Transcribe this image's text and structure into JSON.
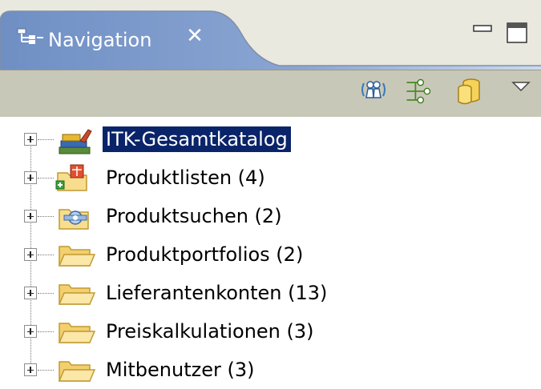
{
  "view": {
    "title": "Navigation",
    "close_symbol": "✕"
  },
  "window_controls": {
    "minimize_icon": "minimize-icon",
    "maximize_icon": "maximize-icon"
  },
  "toolbar": {
    "buttons": [
      {
        "icon": "users-icon"
      },
      {
        "icon": "connection-icon"
      },
      {
        "icon": "database-icon"
      },
      {
        "icon": "view-menu-icon"
      }
    ]
  },
  "tree": {
    "items": [
      {
        "label": "ITK-Gesamtkatalog",
        "icon": "catalog-books-icon",
        "selected": true
      },
      {
        "label": "Produktlisten (4)",
        "icon": "product-list-icon"
      },
      {
        "label": "Produktsuchen (2)",
        "icon": "product-search-icon"
      },
      {
        "label": "Produktportfolios (2)",
        "icon": "folder-icon"
      },
      {
        "label": "Lieferantenkonten (13)",
        "icon": "folder-icon"
      },
      {
        "label": "Preiskalkulationen (3)",
        "icon": "folder-icon"
      },
      {
        "label": "Mitbenutzer (3)",
        "icon": "folder-icon"
      }
    ]
  },
  "colors": {
    "tab_gradient_start": "#7b98c8",
    "tab_gradient_end": "#c4d2ea",
    "toolbar_bg": "#c8c8b8",
    "selection_bg": "#0a246a",
    "folder_fill": "#f8dd8e",
    "folder_stroke": "#c09a32"
  }
}
